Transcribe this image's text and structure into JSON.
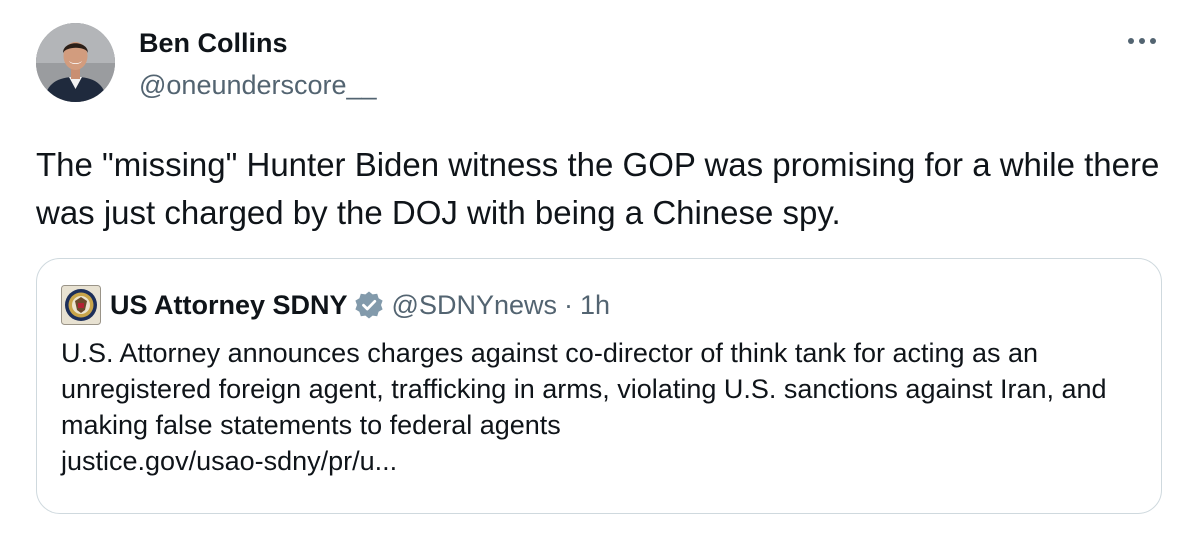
{
  "author": {
    "name": "Ben Collins",
    "handle": "@oneunderscore__",
    "avatar_icon": "profile-photo"
  },
  "menu": {
    "more_icon": "more-horizontal-icon"
  },
  "tweet": {
    "text": "The \"missing\" Hunter Biden witness the GOP was promising for a while there was just charged by the DOJ with being a Chinese spy."
  },
  "quote": {
    "name": "US Attorney SDNY",
    "handle": "@SDNYnews",
    "separator": "·",
    "time": "1h",
    "avatar_icon": "doj-seal-icon",
    "verified_icon": "verified-badge-icon",
    "verified_color": "#829aab",
    "text": "U.S. Attorney announces charges against co-director of think tank for acting as an unregistered foreign agent, trafficking in arms, violating U.S. sanctions against Iran, and making false statements to federal agents",
    "link": "justice.gov/usao-sdny/pr/u..."
  },
  "colors": {
    "text_primary": "#0f1419",
    "text_secondary": "#536471",
    "border": "#cfd9de"
  }
}
